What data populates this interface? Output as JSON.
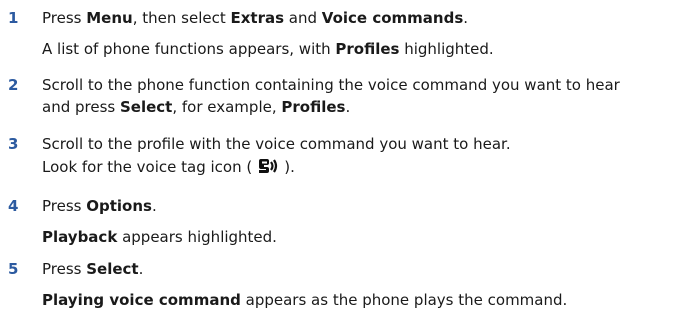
{
  "steps": [
    {
      "number": "1",
      "line1": {
        "t1": "Press ",
        "b1": "Menu",
        "t2": ", then select ",
        "b2": "Extras",
        "t3": " and ",
        "b3": "Voice commands",
        "t4": "."
      },
      "note": {
        "t1": "A list of phone functions appears, with ",
        "b1": "Profiles",
        "t2": " highlighted."
      }
    },
    {
      "number": "2",
      "line1": "Scroll to the phone function containing the voice command you want to hear",
      "line2": {
        "t1": "and press ",
        "b1": "Select",
        "t2": ", for example, ",
        "b2": "Profiles",
        "t3": "."
      }
    },
    {
      "number": "3",
      "line1": "Scroll to the profile with the voice command you want to hear.",
      "line2": {
        "t1": "Look for the voice tag icon (",
        "t2": ")."
      },
      "icon": "voice-tag-icon"
    },
    {
      "number": "4",
      "line1": {
        "t1": "Press ",
        "b1": "Options",
        "t2": "."
      },
      "note": {
        "b1": "Playback",
        "t1": " appears highlighted."
      }
    },
    {
      "number": "5",
      "line1": {
        "t1": "Press ",
        "b1": "Select",
        "t2": "."
      },
      "note": {
        "b1": "Playing voice command",
        "t1": " appears as the phone plays the command."
      }
    }
  ],
  "colors": {
    "step_number": "#2c5aa0",
    "text": "#1a1a1a"
  }
}
